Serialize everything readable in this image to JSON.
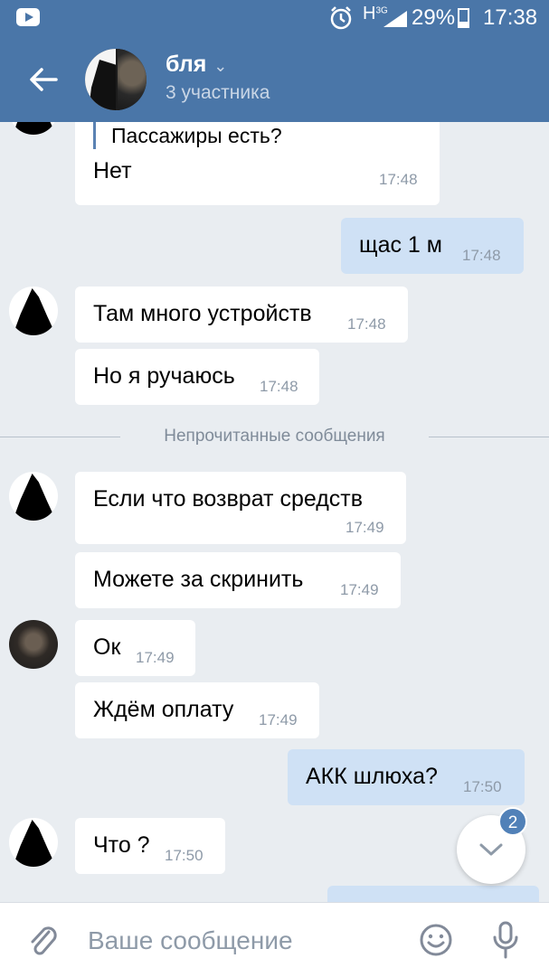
{
  "status_bar": {
    "network": "H",
    "network_sub": "3G",
    "battery": "29%",
    "time": "17:38"
  },
  "header": {
    "title": "бля",
    "subtitle": "3 участника"
  },
  "messages": [
    {
      "quote": "Пассажиры есть?",
      "text": "Нет",
      "time": "17:48",
      "direction": "in"
    },
    {
      "text": "щас 1 м",
      "time": "17:48",
      "direction": "out"
    },
    {
      "text": "Там много устройств",
      "time": "17:48",
      "direction": "in"
    },
    {
      "text": "Но я ручаюсь",
      "time": "17:48",
      "direction": "in"
    },
    {
      "text": "Если что возврат средств",
      "time": "17:49",
      "direction": "in"
    },
    {
      "text": "Можете за скринить",
      "time": "17:49",
      "direction": "in"
    },
    {
      "text": "Ок",
      "time": "17:49",
      "direction": "in"
    },
    {
      "text": "Ждём оплату",
      "time": "17:49",
      "direction": "in"
    },
    {
      "text": "АКК шлюха?",
      "time": "17:50",
      "direction": "out"
    },
    {
      "text": "Что ?",
      "time": "17:50",
      "direction": "in"
    }
  ],
  "unread_divider": "Непрочитанные сообщения",
  "scroll_down_badge": "2",
  "composer": {
    "placeholder": "Ваше сообщение"
  },
  "icons": {
    "back": "arrow-left-icon",
    "dropdown": "chevron-down-icon",
    "attach": "paperclip-icon",
    "emoji": "smiley-icon",
    "mic": "microphone-icon",
    "scroll": "chevron-down-icon"
  },
  "colors": {
    "header": "#4a76a8",
    "background": "#e9edf1",
    "incoming_bubble": "#ffffff",
    "outgoing_bubble": "#cfe1f5",
    "badge": "#5181b8"
  }
}
